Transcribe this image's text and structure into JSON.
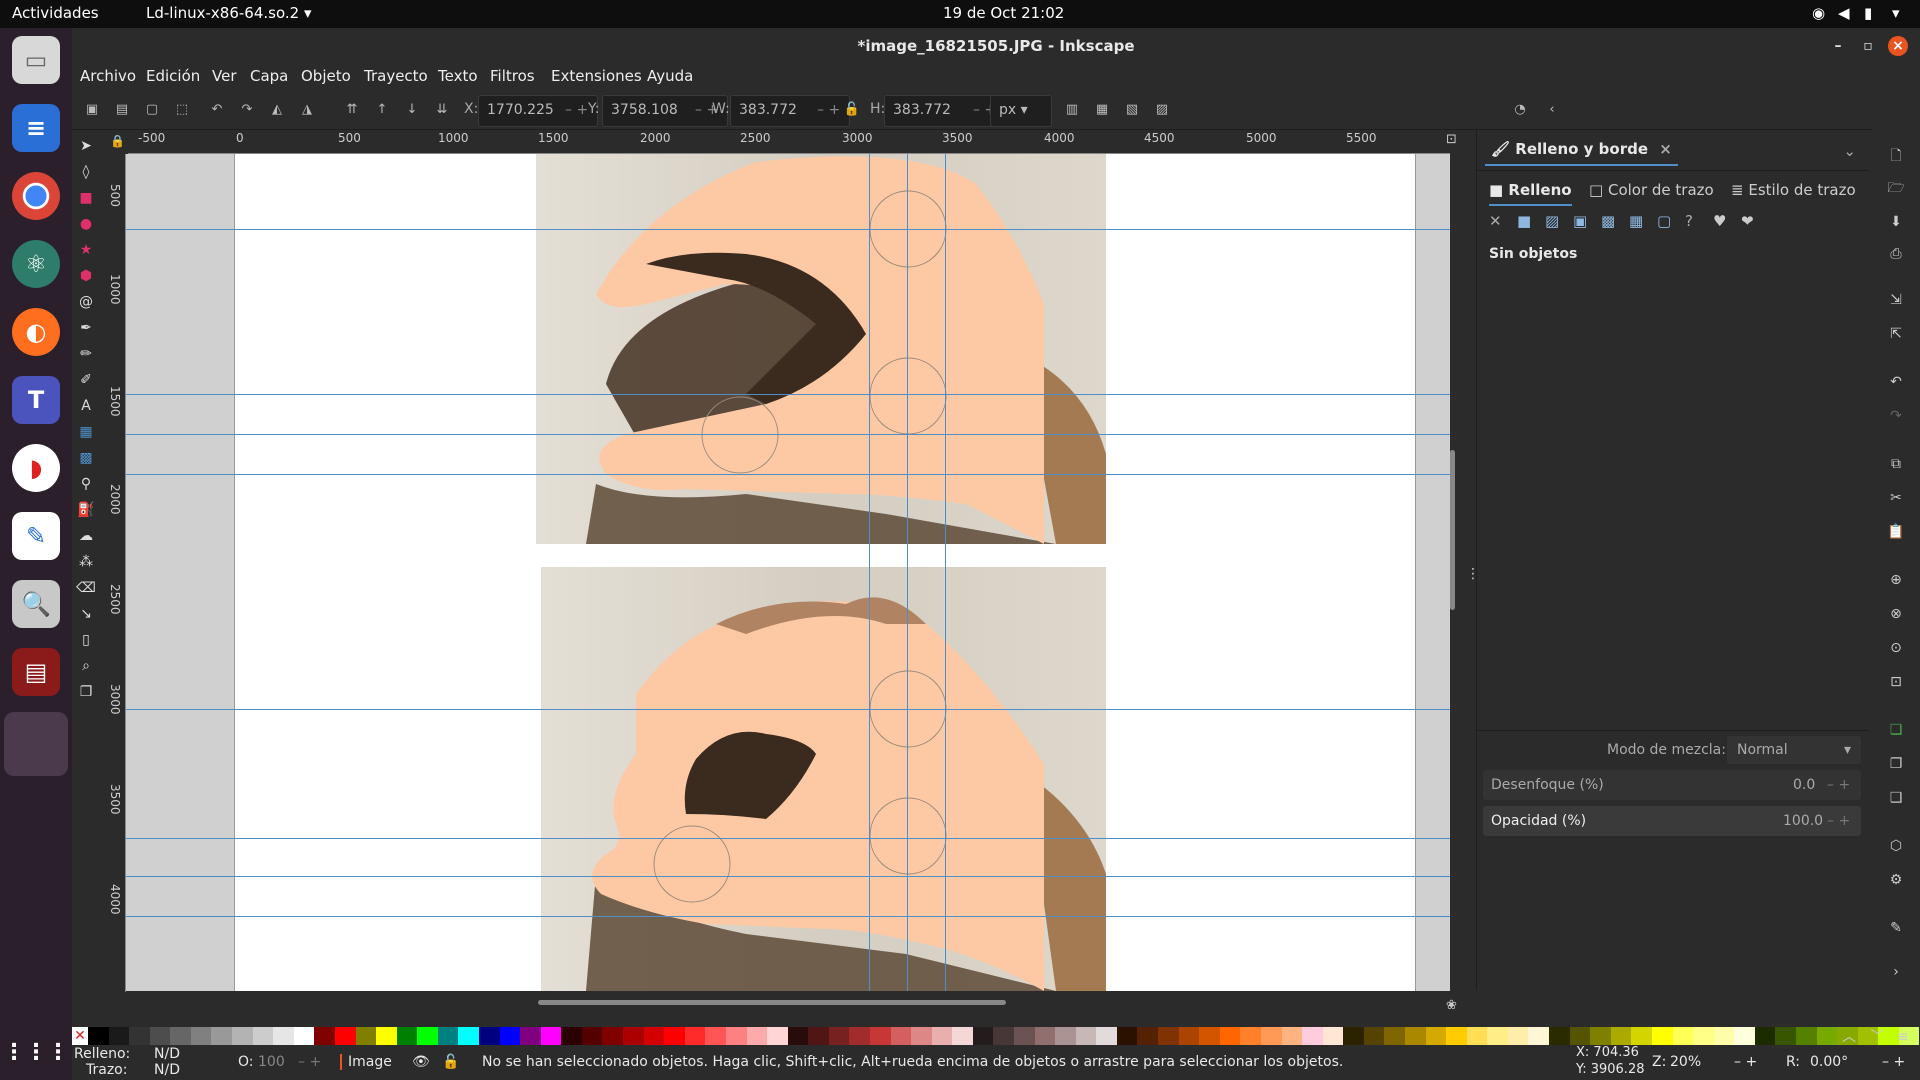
{
  "system": {
    "activities": "Actividades",
    "app_menu": "Ld-linux-x86-64.so.2",
    "clock": "19 de Oct  21:02"
  },
  "window": {
    "title": "*image_16821505.JPG - Inkscape"
  },
  "menu": [
    "Archivo",
    "Edición",
    "Ver",
    "Capa",
    "Objeto",
    "Trayecto",
    "Texto",
    "Filtros",
    "Extensiones",
    "Ayuda"
  ],
  "transform": {
    "x_label": "X:",
    "x_value": "1770.225",
    "y_label": "Y:",
    "y_value": "3758.108",
    "w_label": "W:",
    "w_value": "383.772",
    "h_label": "H:",
    "h_value": "383.772",
    "unit": "px"
  },
  "ruler": {
    "h_ticks": [
      "-500",
      "0",
      "500",
      "1000",
      "1500",
      "2000",
      "2500",
      "3000",
      "3500",
      "4000",
      "4500",
      "5000",
      "5500"
    ],
    "v_ticks": [
      "500",
      "1000",
      "1500",
      "2000",
      "2500",
      "3000",
      "3500",
      "4000"
    ]
  },
  "panel": {
    "tab_title": "Relleno y borde",
    "subtabs": [
      "Relleno",
      "Color de trazo",
      "Estilo de trazo"
    ],
    "no_objects": "Sin objetos",
    "blend_label": "Modo de mezcla:",
    "blend_value": "Normal",
    "blur_label": "Desenfoque (%)",
    "blur_value": "0.0",
    "opacity_label": "Opacidad (%)",
    "opacity_value": "100.0"
  },
  "status": {
    "fill_label": "Relleno:",
    "fill_value": "N/D",
    "stroke_label": "Trazo:",
    "stroke_value": "N/D",
    "o_label": "O:",
    "o_value": "100",
    "layer": "Image",
    "message": "No se han seleccionado objetos. Haga clic, Shift+clic, Alt+rueda encima de objetos o arrastre para seleccionar los objetos.",
    "cursor_x": "X:   704.36",
    "cursor_y": "Y:  3906.28",
    "zoom_label": "Z:",
    "zoom_value": "20%",
    "rotate_label": "R:",
    "rotate_value": "0.00°"
  },
  "colors": {
    "skin": "#fdc9a4",
    "guide": "#4f8fc9",
    "wood": "#d8d2c7"
  }
}
